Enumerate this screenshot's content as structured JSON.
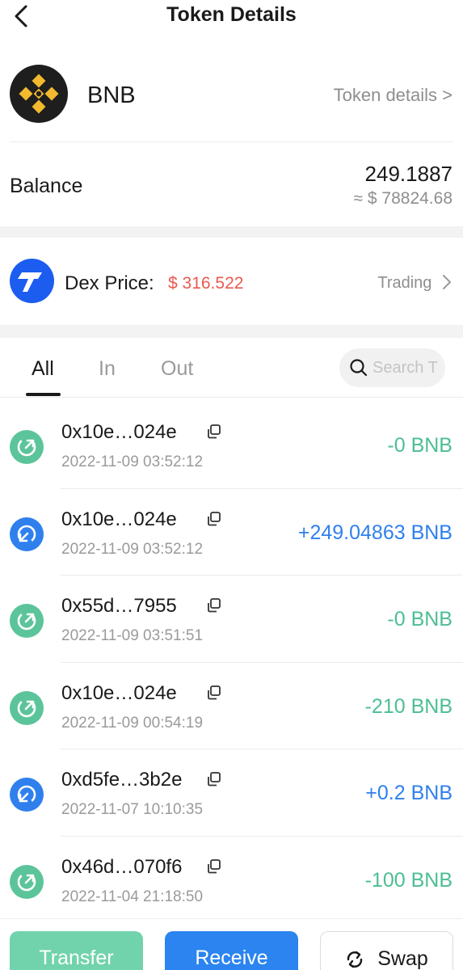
{
  "header": {
    "title": "Token Details"
  },
  "token": {
    "symbol": "BNB",
    "details_link": "Token details >"
  },
  "balance": {
    "label": "Balance",
    "amount": "249.1887",
    "fiat": "≈ $ 78824.68"
  },
  "dex": {
    "label": "Dex Price:",
    "price": "$ 316.522",
    "price_color": "#e95a4f",
    "trading_link": "Trading"
  },
  "tabs": {
    "all": "All",
    "in": "In",
    "out": "Out",
    "active": "All"
  },
  "search": {
    "placeholder": "Search T"
  },
  "transactions": [
    {
      "direction": "out",
      "hash": "0x10e…024e",
      "time": "2022-11-09 03:52:12",
      "amount": "-0 BNB"
    },
    {
      "direction": "in",
      "hash": "0x10e…024e",
      "time": "2022-11-09 03:52:12",
      "amount": "+249.04863 BNB"
    },
    {
      "direction": "out",
      "hash": "0x55d…7955",
      "time": "2022-11-09 03:51:51",
      "amount": "-0 BNB"
    },
    {
      "direction": "out",
      "hash": "0x10e…024e",
      "time": "2022-11-09 00:54:19",
      "amount": "-210 BNB"
    },
    {
      "direction": "in",
      "hash": "0xd5fe…3b2e",
      "time": "2022-11-07 10:10:35",
      "amount": "+0.2 BNB"
    },
    {
      "direction": "out",
      "hash": "0x46d…070f6",
      "time": "2022-11-04 21:18:50",
      "amount": "-100 BNB"
    }
  ],
  "actions": {
    "transfer": "Transfer",
    "receive": "Receive",
    "swap": "Swap"
  },
  "colors": {
    "outgoing": "#4cbe93",
    "incoming": "#2f80ed",
    "transfer_button": "#71d3ab",
    "receive_button": "#2b84ef",
    "bnb_yellow": "#f3ba2f"
  },
  "icons": {
    "back": "chevron-left-icon",
    "bnb": "bnb-logo-icon",
    "dex": "dex-logo-icon",
    "search": "search-icon",
    "copy": "copy-icon",
    "out": "arrow-up-right-circle-icon",
    "in": "arrow-down-left-circle-icon",
    "swap": "swap-icon"
  }
}
